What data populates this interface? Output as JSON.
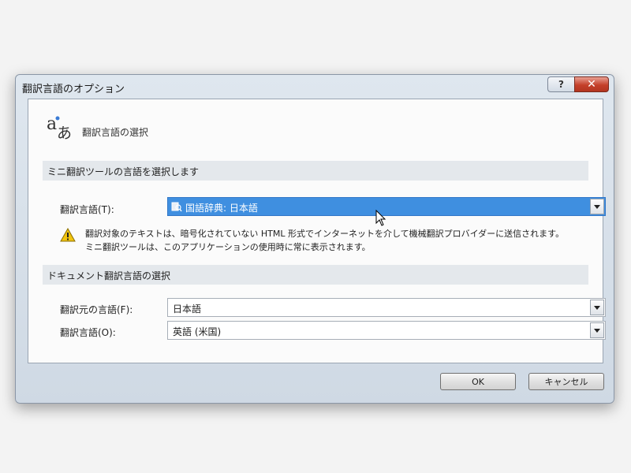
{
  "dialog": {
    "title": "翻訳言語のオプション",
    "help_label": "?",
    "close_label": "✕",
    "header_title": "翻訳言語の選択",
    "header_icon": "translate-icon"
  },
  "mini_section": {
    "title": "ミニ翻訳ツールの言語を選択します",
    "language_label": "翻訳言語(T):",
    "language_value": "国語辞典: 日本語",
    "language_icon": "dictionary-icon",
    "warning_line1": "翻訳対象のテキストは、暗号化されていない HTML 形式でインターネットを介して機械翻訳プロバイダーに送信されます。",
    "warning_line2": "ミニ翻訳ツールは、このアプリケーションの使用時に常に表示されます。",
    "warning_icon": "warning-icon"
  },
  "doc_section": {
    "title": "ドキュメント翻訳言語の選択",
    "source_label": "翻訳元の言語(F):",
    "source_value": "日本語",
    "target_label": "翻訳言語(O):",
    "target_value": "英語 (米国)"
  },
  "buttons": {
    "ok": "OK",
    "cancel": "キャンセル"
  },
  "colors": {
    "selection": "#3f8fe0",
    "close_button": "#c4402a",
    "warning": "#f1c40f"
  }
}
